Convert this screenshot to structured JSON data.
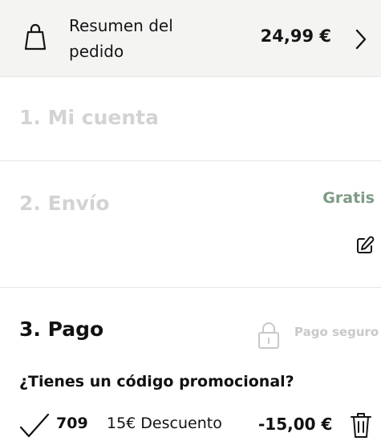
{
  "summary": {
    "label": "Resumen del pedido",
    "total": "24,99 €",
    "icons": {
      "bag": "shopping-bag-icon",
      "expand": "chevron-right-icon"
    }
  },
  "steps": [
    {
      "title": "1. Mi cuenta"
    },
    {
      "title": "2. Envío",
      "shipping_cost": "Gratis",
      "edit_icon": "edit-icon"
    },
    {
      "title": "3. Pago",
      "secure_label": "Pago seguro",
      "secure_icon": "lock-icon"
    }
  ],
  "promo": {
    "question": "¿Tienes un código promocional?",
    "code": "709",
    "description": "15€ Descuento",
    "amount": "-15,00 €",
    "icons": {
      "applied": "checkmark-icon",
      "remove": "trash-icon"
    }
  },
  "colors": {
    "summary_background": "#f4f4f3",
    "muted_step_title": "#d3d3d3",
    "free_shipping": "#7f9b85",
    "secure_label": "#c9c9c9",
    "text": "#111111"
  }
}
